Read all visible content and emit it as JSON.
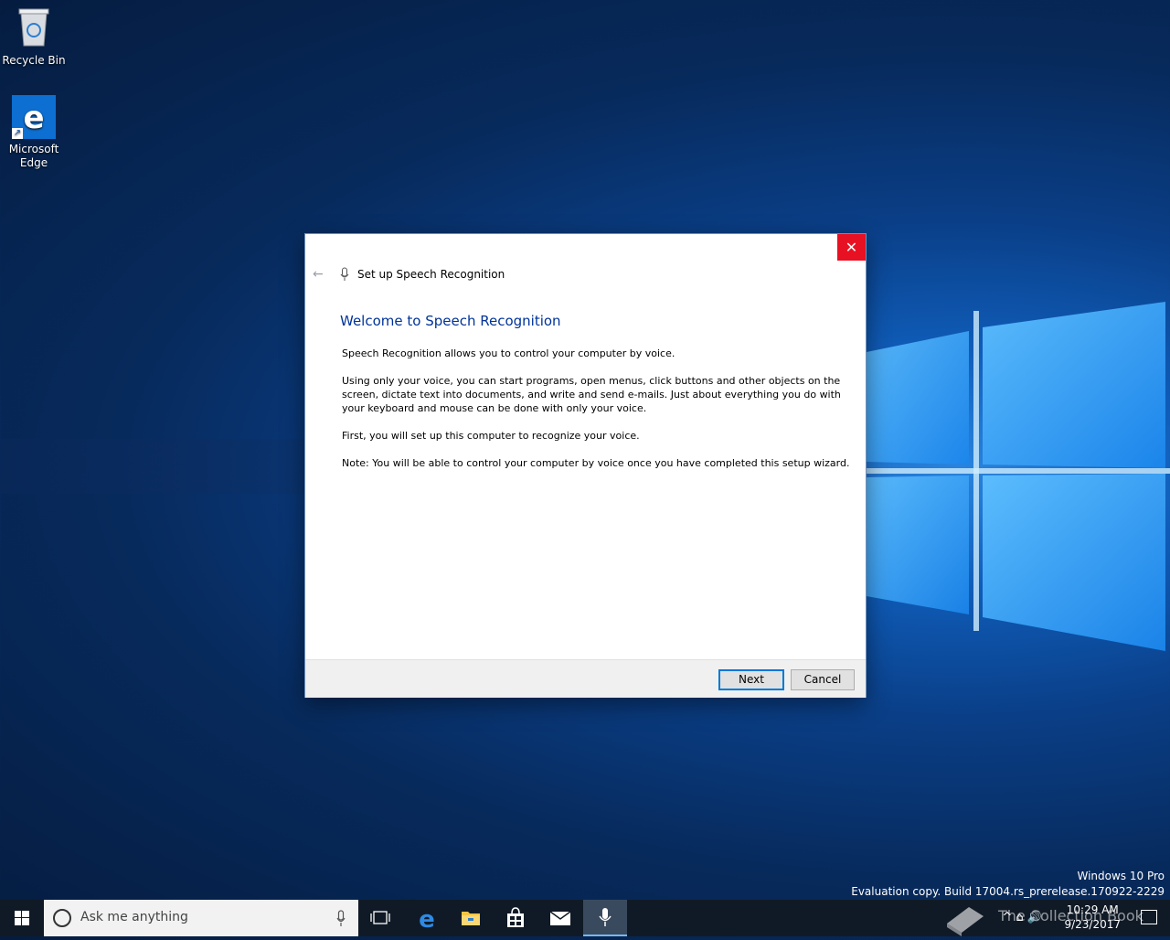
{
  "desktop": {
    "icons": [
      {
        "label": "Recycle Bin",
        "icon": "recycle-bin-icon"
      },
      {
        "label": "Microsoft Edge",
        "icon": "edge-icon"
      }
    ]
  },
  "dialog": {
    "title": "Set up Speech Recognition",
    "heading": "Welcome to Speech Recognition",
    "paragraphs": [
      "Speech Recognition allows you to control your computer by voice.",
      "Using only your voice, you can start programs, open menus, click buttons and other objects on the screen, dictate text into documents, and write and send e-mails. Just about everything you do with your keyboard and mouse can be done with only your voice.",
      "First, you will set up this computer to recognize your voice.",
      "Note: You will be able to control your computer by voice once you have completed this setup wizard."
    ],
    "next_label": "Next",
    "cancel_label": "Cancel",
    "close_glyph": "✕",
    "back_glyph": "←"
  },
  "watermark": {
    "edition": "Windows 10 Pro",
    "build": "Evaluation copy. Build 17004.rs_prerelease.170922-2229",
    "collection": "The Collection Book"
  },
  "taskbar": {
    "search_placeholder": "Ask me anything",
    "time": "10:29 AM",
    "date": "9/23/2017",
    "tray_glyphs": "^  ⌂  🔊"
  },
  "colors": {
    "accent": "#0078d7",
    "close_red": "#e81123",
    "heading_blue": "#003399"
  }
}
